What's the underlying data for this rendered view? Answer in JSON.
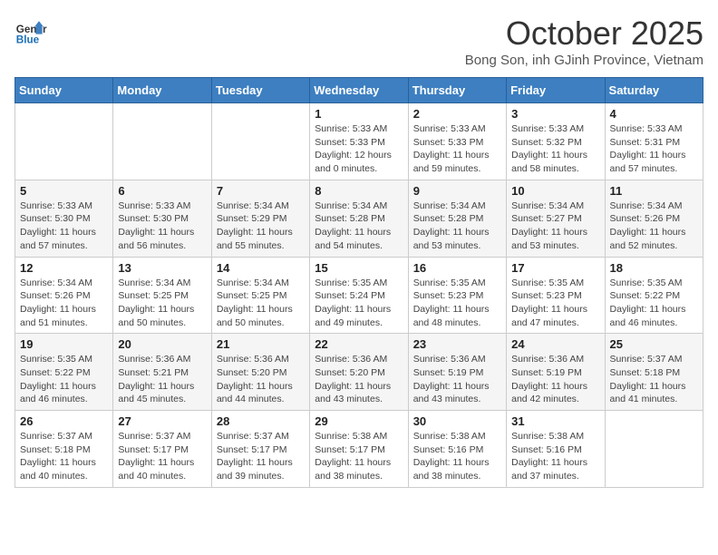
{
  "header": {
    "logo_line1": "General",
    "logo_line2": "Blue",
    "month": "October 2025",
    "location": "Bong Son, inh GJinh Province, Vietnam"
  },
  "weekdays": [
    "Sunday",
    "Monday",
    "Tuesday",
    "Wednesday",
    "Thursday",
    "Friday",
    "Saturday"
  ],
  "weeks": [
    [
      {
        "day": "",
        "info": ""
      },
      {
        "day": "",
        "info": ""
      },
      {
        "day": "",
        "info": ""
      },
      {
        "day": "1",
        "info": "Sunrise: 5:33 AM\nSunset: 5:33 PM\nDaylight: 12 hours\nand 0 minutes."
      },
      {
        "day": "2",
        "info": "Sunrise: 5:33 AM\nSunset: 5:33 PM\nDaylight: 11 hours\nand 59 minutes."
      },
      {
        "day": "3",
        "info": "Sunrise: 5:33 AM\nSunset: 5:32 PM\nDaylight: 11 hours\nand 58 minutes."
      },
      {
        "day": "4",
        "info": "Sunrise: 5:33 AM\nSunset: 5:31 PM\nDaylight: 11 hours\nand 57 minutes."
      }
    ],
    [
      {
        "day": "5",
        "info": "Sunrise: 5:33 AM\nSunset: 5:30 PM\nDaylight: 11 hours\nand 57 minutes."
      },
      {
        "day": "6",
        "info": "Sunrise: 5:33 AM\nSunset: 5:30 PM\nDaylight: 11 hours\nand 56 minutes."
      },
      {
        "day": "7",
        "info": "Sunrise: 5:34 AM\nSunset: 5:29 PM\nDaylight: 11 hours\nand 55 minutes."
      },
      {
        "day": "8",
        "info": "Sunrise: 5:34 AM\nSunset: 5:28 PM\nDaylight: 11 hours\nand 54 minutes."
      },
      {
        "day": "9",
        "info": "Sunrise: 5:34 AM\nSunset: 5:28 PM\nDaylight: 11 hours\nand 53 minutes."
      },
      {
        "day": "10",
        "info": "Sunrise: 5:34 AM\nSunset: 5:27 PM\nDaylight: 11 hours\nand 53 minutes."
      },
      {
        "day": "11",
        "info": "Sunrise: 5:34 AM\nSunset: 5:26 PM\nDaylight: 11 hours\nand 52 minutes."
      }
    ],
    [
      {
        "day": "12",
        "info": "Sunrise: 5:34 AM\nSunset: 5:26 PM\nDaylight: 11 hours\nand 51 minutes."
      },
      {
        "day": "13",
        "info": "Sunrise: 5:34 AM\nSunset: 5:25 PM\nDaylight: 11 hours\nand 50 minutes."
      },
      {
        "day": "14",
        "info": "Sunrise: 5:34 AM\nSunset: 5:25 PM\nDaylight: 11 hours\nand 50 minutes."
      },
      {
        "day": "15",
        "info": "Sunrise: 5:35 AM\nSunset: 5:24 PM\nDaylight: 11 hours\nand 49 minutes."
      },
      {
        "day": "16",
        "info": "Sunrise: 5:35 AM\nSunset: 5:23 PM\nDaylight: 11 hours\nand 48 minutes."
      },
      {
        "day": "17",
        "info": "Sunrise: 5:35 AM\nSunset: 5:23 PM\nDaylight: 11 hours\nand 47 minutes."
      },
      {
        "day": "18",
        "info": "Sunrise: 5:35 AM\nSunset: 5:22 PM\nDaylight: 11 hours\nand 46 minutes."
      }
    ],
    [
      {
        "day": "19",
        "info": "Sunrise: 5:35 AM\nSunset: 5:22 PM\nDaylight: 11 hours\nand 46 minutes."
      },
      {
        "day": "20",
        "info": "Sunrise: 5:36 AM\nSunset: 5:21 PM\nDaylight: 11 hours\nand 45 minutes."
      },
      {
        "day": "21",
        "info": "Sunrise: 5:36 AM\nSunset: 5:20 PM\nDaylight: 11 hours\nand 44 minutes."
      },
      {
        "day": "22",
        "info": "Sunrise: 5:36 AM\nSunset: 5:20 PM\nDaylight: 11 hours\nand 43 minutes."
      },
      {
        "day": "23",
        "info": "Sunrise: 5:36 AM\nSunset: 5:19 PM\nDaylight: 11 hours\nand 43 minutes."
      },
      {
        "day": "24",
        "info": "Sunrise: 5:36 AM\nSunset: 5:19 PM\nDaylight: 11 hours\nand 42 minutes."
      },
      {
        "day": "25",
        "info": "Sunrise: 5:37 AM\nSunset: 5:18 PM\nDaylight: 11 hours\nand 41 minutes."
      }
    ],
    [
      {
        "day": "26",
        "info": "Sunrise: 5:37 AM\nSunset: 5:18 PM\nDaylight: 11 hours\nand 40 minutes."
      },
      {
        "day": "27",
        "info": "Sunrise: 5:37 AM\nSunset: 5:17 PM\nDaylight: 11 hours\nand 40 minutes."
      },
      {
        "day": "28",
        "info": "Sunrise: 5:37 AM\nSunset: 5:17 PM\nDaylight: 11 hours\nand 39 minutes."
      },
      {
        "day": "29",
        "info": "Sunrise: 5:38 AM\nSunset: 5:17 PM\nDaylight: 11 hours\nand 38 minutes."
      },
      {
        "day": "30",
        "info": "Sunrise: 5:38 AM\nSunset: 5:16 PM\nDaylight: 11 hours\nand 38 minutes."
      },
      {
        "day": "31",
        "info": "Sunrise: 5:38 AM\nSunset: 5:16 PM\nDaylight: 11 hours\nand 37 minutes."
      },
      {
        "day": "",
        "info": ""
      }
    ]
  ]
}
